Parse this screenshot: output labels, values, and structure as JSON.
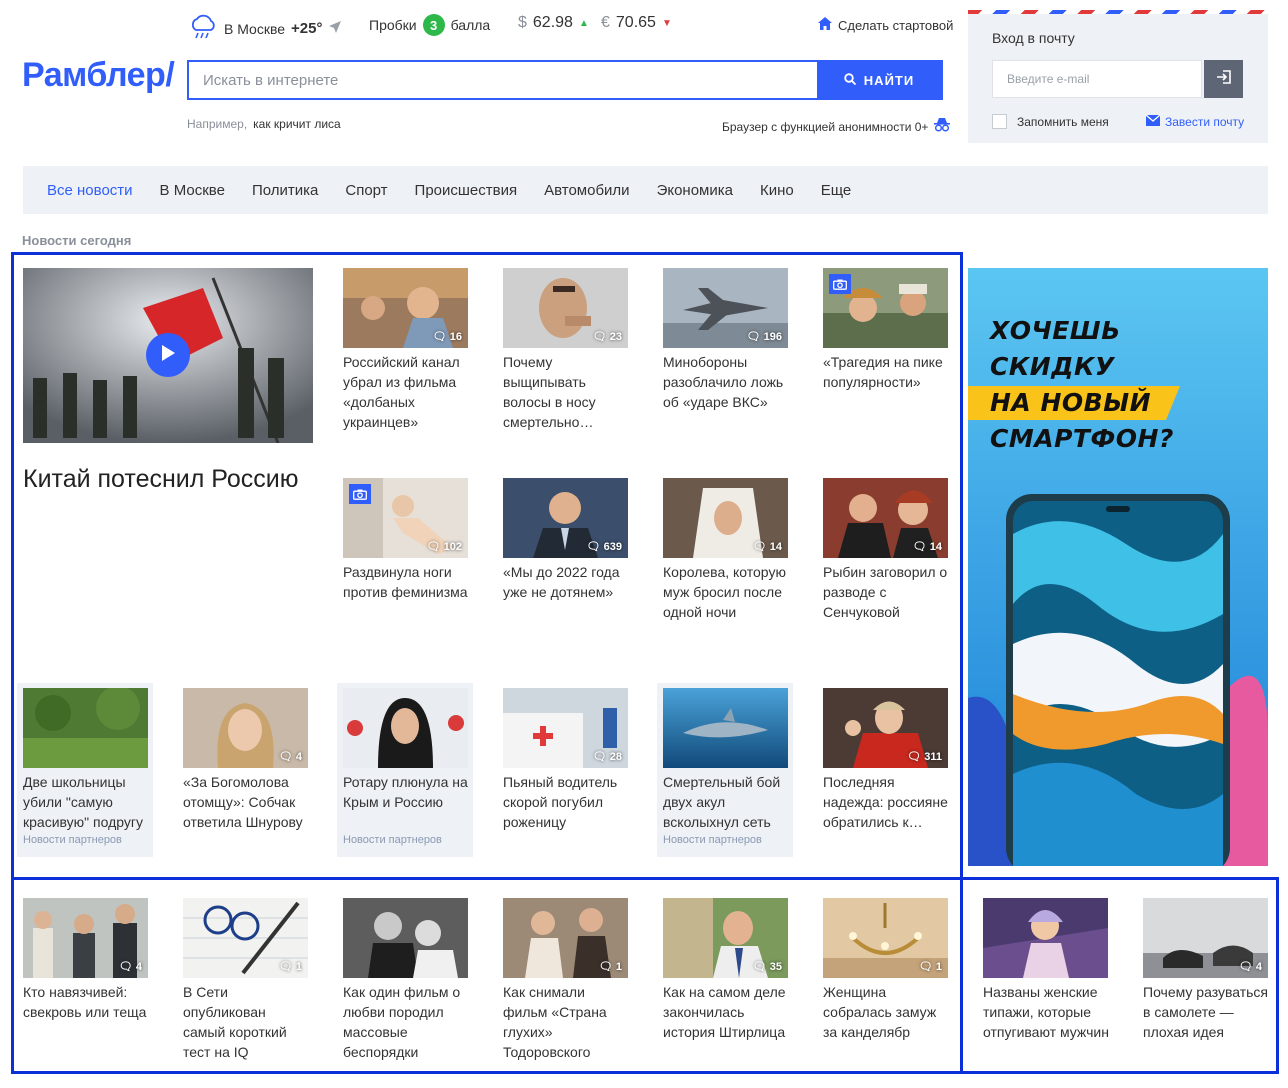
{
  "header": {
    "weather": {
      "city": "В Москве",
      "temp": "+25°"
    },
    "traffic": {
      "label": "Пробки",
      "score": "3",
      "unit": "балла"
    },
    "usd": {
      "symbol": "$",
      "value": "62.98",
      "trend": "▲"
    },
    "eur": {
      "symbol": "€",
      "value": "70.65",
      "trend": "▼"
    },
    "make_start_label": "Сделать стартовой",
    "logo_text": "Рамблер/",
    "search": {
      "placeholder": "Искать в интернете",
      "button_label": "НАЙТИ"
    },
    "example": {
      "label": "Например,",
      "query": "как кричит лиса"
    },
    "anon_browser": "Браузер с функцией анонимности 0+"
  },
  "login": {
    "title": "Вход в почту",
    "email_placeholder": "Введите e-mail",
    "remember_label": "Запомнить меня",
    "create_mail_label": "Завести почту"
  },
  "nav": {
    "items": [
      "Все новости",
      "В Москве",
      "Политика",
      "Спорт",
      "Происшествия",
      "Автомобили",
      "Экономика",
      "Кино",
      "Еще"
    ]
  },
  "section_label": "Новости сегодня",
  "hero": {
    "title": "Китай потеснил Россию"
  },
  "cards": [
    {
      "title": "Российский канал убрал из фильма «долбаных украинцев»",
      "comments": "16"
    },
    {
      "title": "Почему выщипывать волосы в носу смертельно…",
      "comments": "23"
    },
    {
      "title": "Минобороны разоблачило ложь об «ударе ВКС»",
      "comments": "196"
    },
    {
      "title": "«Трагедия на пике популярности»",
      "comments": ""
    },
    {
      "title": "Раздвинула ноги против феминизма",
      "comments": "102"
    },
    {
      "title": "«Мы до 2022 года уже не дотянем»",
      "comments": "639"
    },
    {
      "title": "Королева, которую муж бросил после одной ночи",
      "comments": "14"
    },
    {
      "title": "Рыбин заговорил о разводе с Сенчуковой",
      "comments": "14"
    },
    {
      "title": "Две школьницы убили \"самую красивую\" подругу",
      "comments": "",
      "partner": "Новости партнеров"
    },
    {
      "title": "«За Богомолова отомщу»: Собчак ответила Шнурову",
      "comments": "4"
    },
    {
      "title": "Ротару плюнула на Крым и Россию",
      "comments": "",
      "partner": "Новости партнеров"
    },
    {
      "title": "Пьяный водитель скорой погубил роженицу",
      "comments": "28"
    },
    {
      "title": "Смертельный бой двух акул всколыхнул сеть",
      "comments": "",
      "partner": "Новости партнеров"
    },
    {
      "title": "Последняя надежда: россияне обратились к…",
      "comments": "311"
    },
    {
      "title": "Кто навязчивей: свекровь или теща",
      "comments": "4"
    },
    {
      "title": "В Сети опубликован самый короткий тест на IQ",
      "comments": "1"
    },
    {
      "title": "Как один фильм о любви породил массовые беспорядки",
      "comments": ""
    },
    {
      "title": "Как снимали фильм «Страна глухих» Тодоровского",
      "comments": "1"
    },
    {
      "title": "Как на самом деле закончилась история Штирлица",
      "comments": "35"
    },
    {
      "title": "Женщина собралась замуж за канделябр",
      "comments": "1"
    },
    {
      "title": "Названы женские типажи, которые отпугивают мужчин",
      "comments": ""
    },
    {
      "title": "Почему разуваться в самолете — плохая идея",
      "comments": "4"
    }
  ],
  "ad": {
    "lines": [
      "ХОЧЕШЬ",
      "СКИДКУ",
      "НА НОВЫЙ",
      "СМАРТФОН?"
    ],
    "highlight_color": "#f9c31a"
  },
  "colors": {
    "accent": "#315efb",
    "outline": "#0b2fd8",
    "panel": "#eef1f5"
  }
}
